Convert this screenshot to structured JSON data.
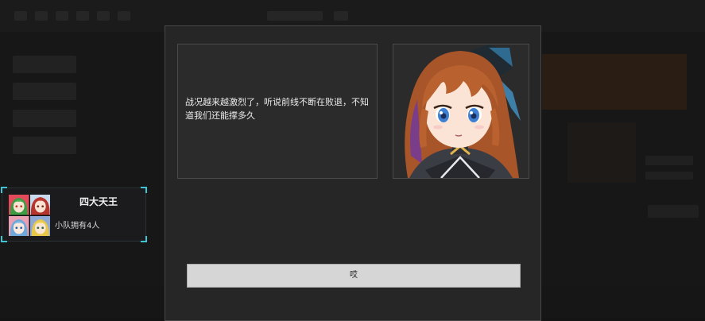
{
  "dialog": {
    "message": "战况越来越激烈了，听说前线不断在败退，不知道我们还能撑多久",
    "confirm_label": "哎",
    "portrait": "brown-haired-girl-portrait"
  },
  "squad": {
    "name": "四大天王",
    "description": "小队拥有4人",
    "members": [
      "green-haired-girl",
      "red-haired-girl",
      "blue-haired-girl",
      "blonde-girl"
    ]
  },
  "colors": {
    "accent": "#3fc4d6",
    "dialog_bg": "#262626",
    "button_bg": "#d6d6d6"
  }
}
